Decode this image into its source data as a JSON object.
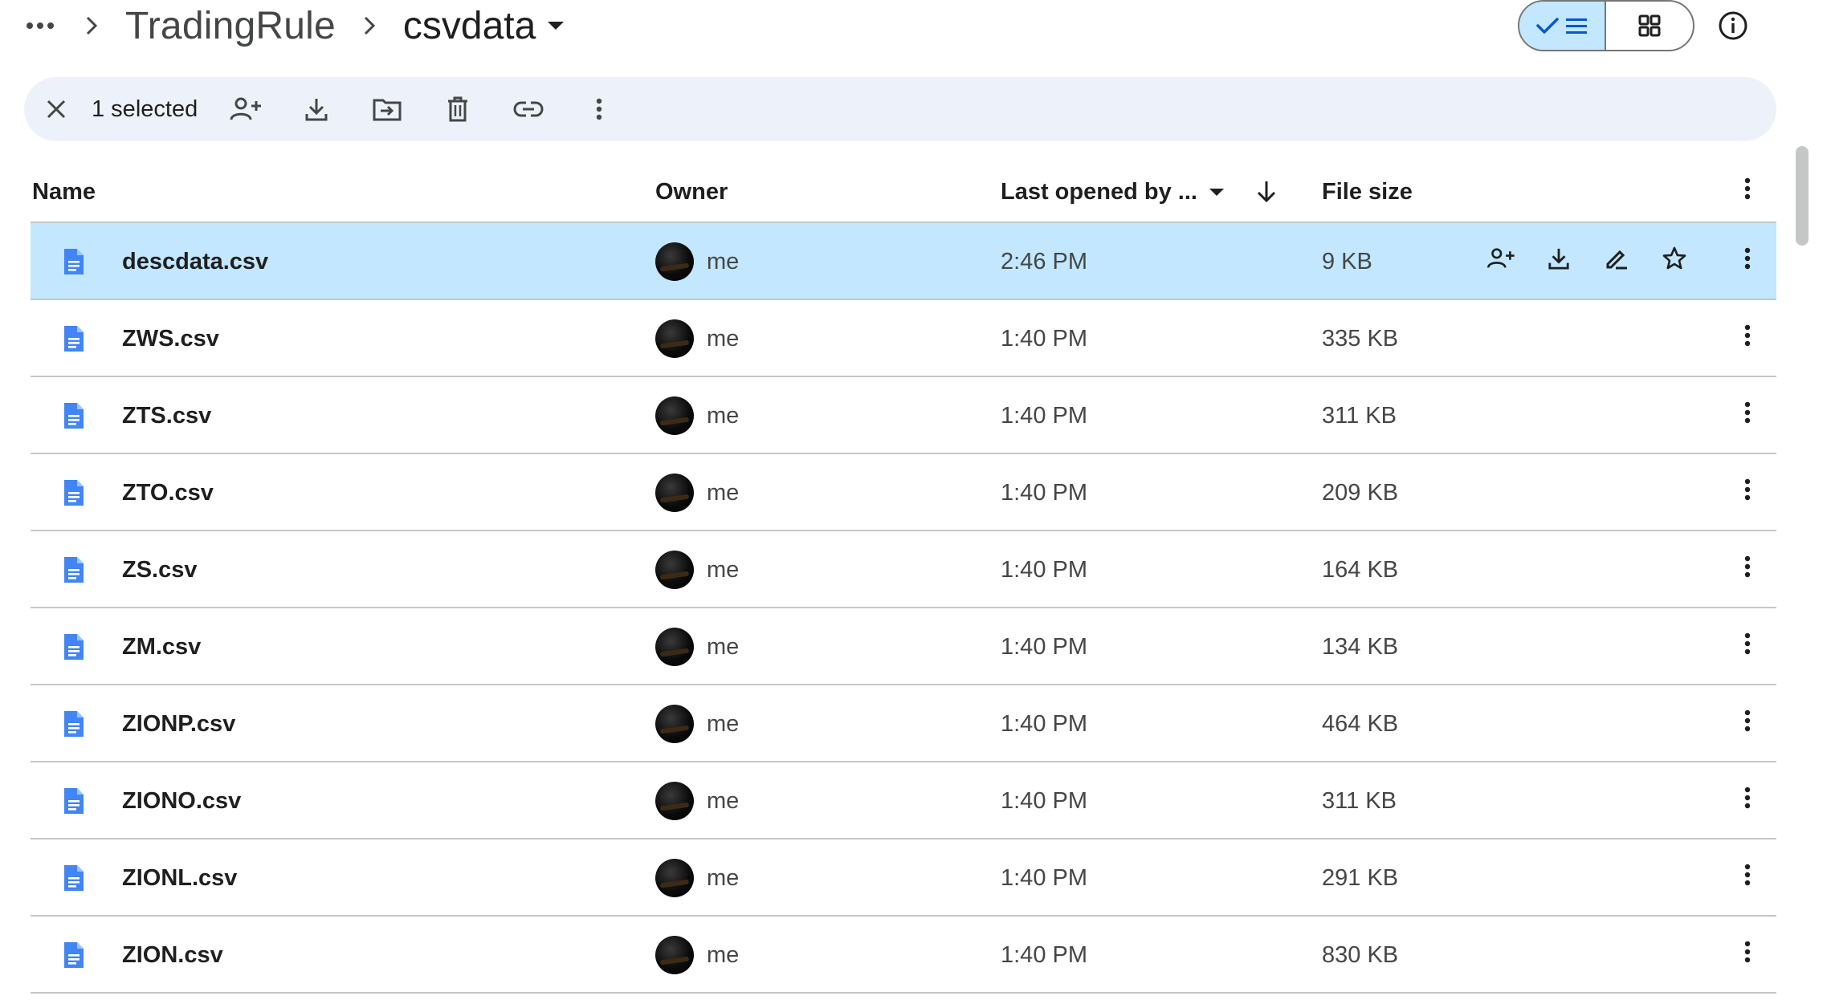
{
  "breadcrumb": {
    "parent": "TradingRule",
    "current": "csvdata"
  },
  "selection": {
    "count_label": "1 selected"
  },
  "table": {
    "columns": {
      "name": "Name",
      "owner": "Owner",
      "last_opened": "Last opened by ...",
      "file_size": "File size"
    },
    "rows": [
      {
        "name": "descdata.csv",
        "owner": "me",
        "time": "2:46 PM",
        "size": "9 KB",
        "selected": true
      },
      {
        "name": "ZWS.csv",
        "owner": "me",
        "time": "1:40 PM",
        "size": "335 KB"
      },
      {
        "name": "ZTS.csv",
        "owner": "me",
        "time": "1:40 PM",
        "size": "311 KB"
      },
      {
        "name": "ZTO.csv",
        "owner": "me",
        "time": "1:40 PM",
        "size": "209 KB"
      },
      {
        "name": "ZS.csv",
        "owner": "me",
        "time": "1:40 PM",
        "size": "164 KB"
      },
      {
        "name": "ZM.csv",
        "owner": "me",
        "time": "1:40 PM",
        "size": "134 KB"
      },
      {
        "name": "ZIONP.csv",
        "owner": "me",
        "time": "1:40 PM",
        "size": "464 KB"
      },
      {
        "name": "ZIONO.csv",
        "owner": "me",
        "time": "1:40 PM",
        "size": "311 KB"
      },
      {
        "name": "ZIONL.csv",
        "owner": "me",
        "time": "1:40 PM",
        "size": "291 KB"
      },
      {
        "name": "ZION.csv",
        "owner": "me",
        "time": "1:40 PM",
        "size": "830 KB"
      }
    ]
  },
  "colors": {
    "selected_row": "#c2e7ff",
    "selection_bar": "#edf2fa",
    "doc_icon": "#4285f4"
  },
  "icons": [
    "more-horiz-icon",
    "chevron-right-icon",
    "arrow-drop-down-icon",
    "check-icon",
    "list-icon",
    "grid-icon",
    "info-icon",
    "close-icon",
    "share-icon",
    "download-icon",
    "move-icon",
    "trash-icon",
    "link-icon",
    "more-vert-icon",
    "arrow-down-icon",
    "doc-icon",
    "rename-icon",
    "star-icon"
  ]
}
